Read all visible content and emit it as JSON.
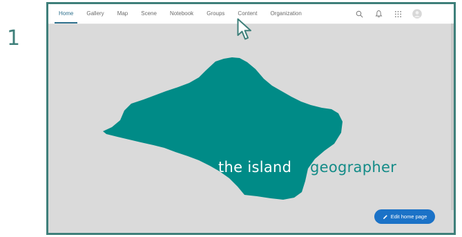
{
  "step": {
    "number": "1"
  },
  "nav": {
    "tabs": [
      "Home",
      "Gallery",
      "Map",
      "Scene",
      "Notebook",
      "Groups",
      "Content",
      "Organization"
    ],
    "active_tab": "Home",
    "icons": [
      "search-icon",
      "bell-icon",
      "apps-grid-icon",
      "avatar"
    ]
  },
  "hero": {
    "title_part1": "the island",
    "title_part2": "geographer",
    "edit_button_label": "Edit home page"
  },
  "colors": {
    "accent": "#3e7f7a",
    "island": "#008b87",
    "background": "#dadada",
    "button": "#1b72c7",
    "active_tab": "#2d6f8c"
  }
}
